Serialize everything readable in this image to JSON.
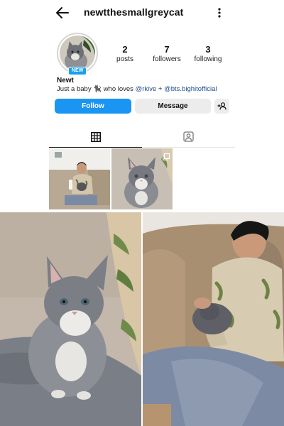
{
  "header": {
    "username": "newtthesmallgreycat"
  },
  "profile": {
    "badge": "NEW",
    "display_name": "Newt",
    "bio": {
      "prefix": "Just a baby 🐈‍⬛ who loves ",
      "mention1": "@rkive",
      "joiner": " + ",
      "mention2": "@bts.bighitofficial"
    },
    "stats": [
      {
        "value": "2",
        "label": "posts"
      },
      {
        "value": "7",
        "label": "followers"
      },
      {
        "value": "3",
        "label": "following"
      }
    ]
  },
  "actions": {
    "follow_label": "Follow",
    "message_label": "Message"
  },
  "tabs": [
    "grid-icon",
    "tagged-icon"
  ],
  "colors": {
    "accent": "#1b95f3",
    "badge": "#1a9ff0",
    "mention": "#1e4d8c"
  }
}
